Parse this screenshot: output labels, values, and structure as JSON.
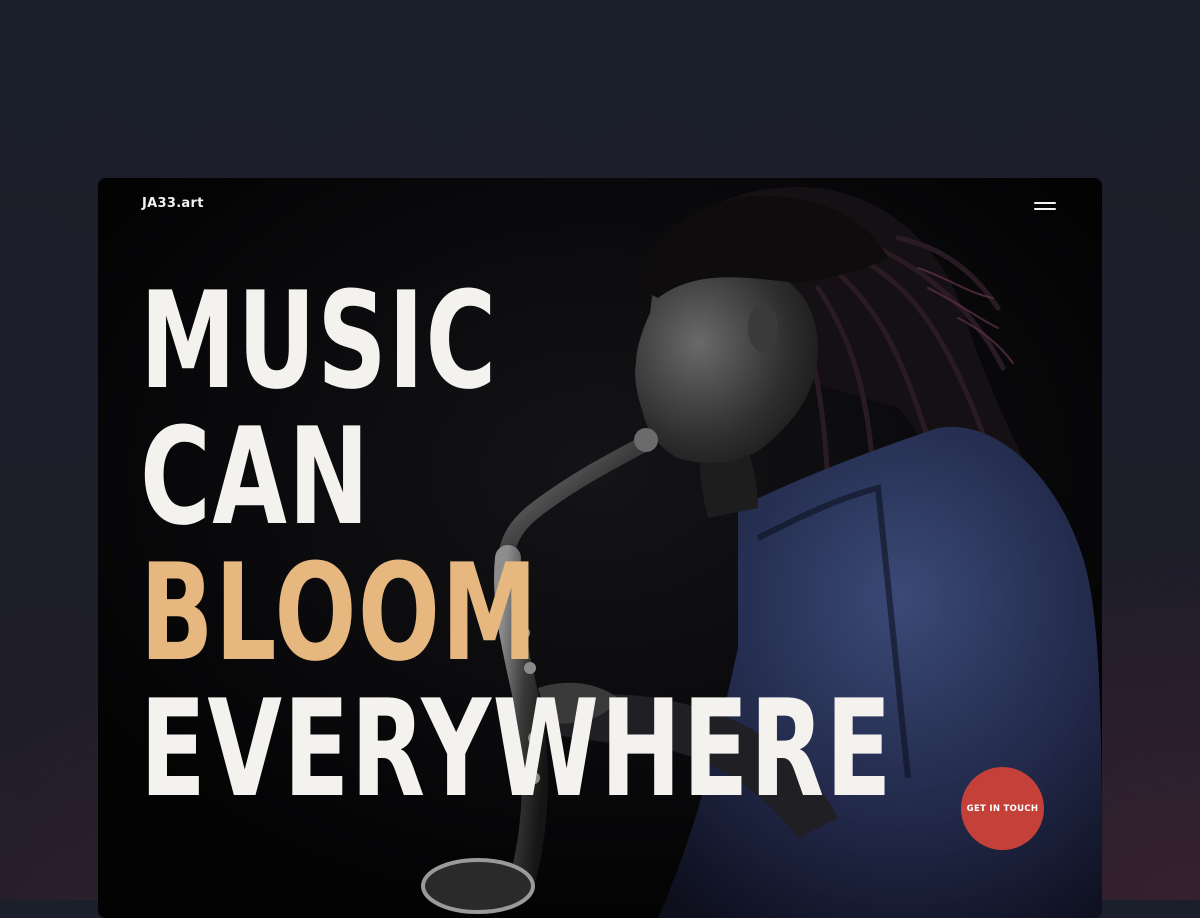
{
  "brand": {
    "logo_text": "JA33.art"
  },
  "header": {
    "menu_icon": "hamburger-menu-icon"
  },
  "hero": {
    "lines": [
      "MUSIC",
      "CAN",
      "BLOOM",
      "EVERYWHERE"
    ],
    "accent_line_index": 2,
    "image": "saxophonist-photo"
  },
  "cta": {
    "label": "GET IN TOUCH"
  },
  "colors": {
    "page_background": "#1c1e2b",
    "frame_background": "#030304",
    "headline": "#f4f2ee",
    "accent": "#e6b77f",
    "cta_background": "#c4413a"
  }
}
